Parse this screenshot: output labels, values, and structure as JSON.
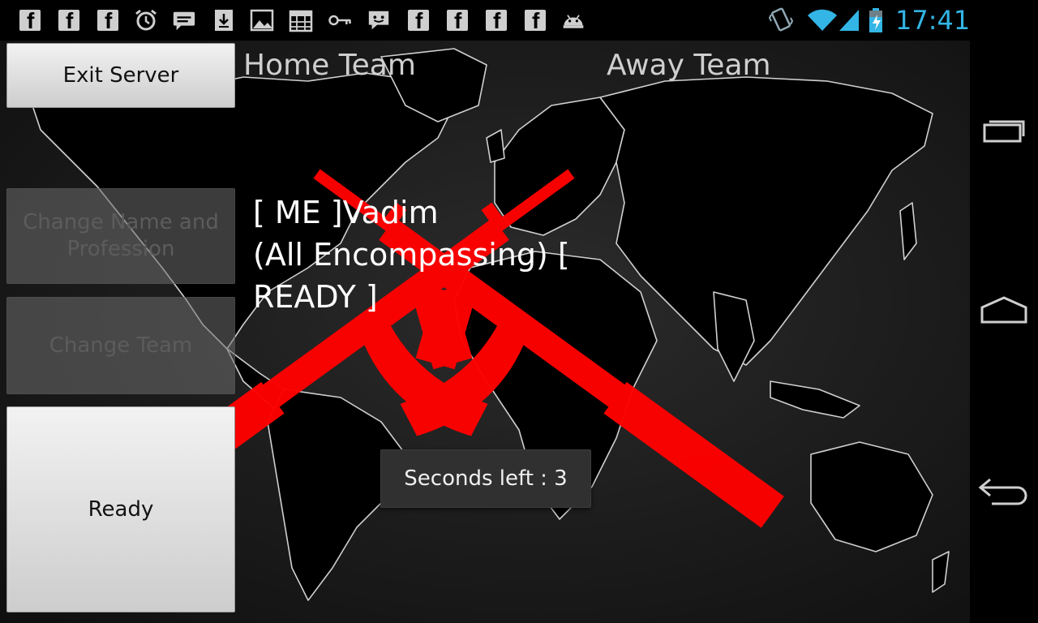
{
  "status_bar": {
    "time": "17:41",
    "notification_icons": [
      "facebook-icon",
      "facebook-icon",
      "facebook-icon",
      "alarm-icon",
      "chat-icon",
      "download-icon",
      "gallery-icon",
      "calendar-icon",
      "key-icon",
      "messenger-icon",
      "facebook-icon",
      "facebook-icon",
      "facebook-icon",
      "facebook-icon",
      "android-icon"
    ],
    "system_icons": [
      "vibrate-icon",
      "wifi-icon",
      "signal-icon",
      "battery-charging-icon"
    ],
    "accent_color": "#33b5e5"
  },
  "buttons": {
    "exit_server": "Exit Server",
    "change_name": "Change Name and Profession",
    "change_team": "Change Team",
    "ready": "Ready"
  },
  "teams": {
    "home": "Home Team",
    "away": "Away Team"
  },
  "player_entry": "[ ME ]Vadim\n(All Encompassing) [\nREADY ]",
  "toast": "Seconds left : 3",
  "colors": {
    "emblem_red": "#ff0000",
    "map_outline": "#d0d0d0"
  }
}
